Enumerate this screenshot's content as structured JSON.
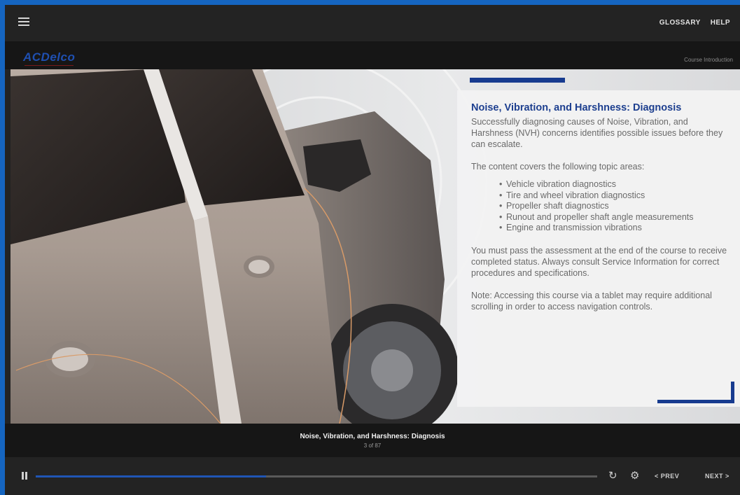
{
  "header": {
    "menu_icon": "hamburger-menu-icon",
    "links": [
      "GLOSSARY",
      "HELP"
    ]
  },
  "brand": {
    "logo_text": "ACDelco",
    "section_label": "Course Introduction"
  },
  "card": {
    "title": "Noise, Vibration, and Harshness: Diagnosis",
    "intro": "Successfully diagnosing causes of Noise, Vibration, and Harshness (NVH) concerns identifies possible issues before they can escalate.",
    "topics_lead": "The content covers the following topic areas:",
    "topics": [
      "Vehicle vibration diagnostics",
      "Tire and wheel vibration diagnostics",
      "Propeller shaft diagnostics",
      "Runout and propeller shaft angle measurements",
      "Engine and transmission vibrations"
    ],
    "assessment_note": "You must pass the assessment at the end of the course to receive completed status. Always consult Service Information for correct procedures and specifications.",
    "tablet_note": "Note: Accessing this course via a tablet may require additional scrolling in order to access navigation controls."
  },
  "slide_bar": {
    "title": "Noise, Vibration, and Harshness: Diagnosis",
    "counter": "3 of 87"
  },
  "controls": {
    "pause_icon": "pause-icon",
    "progress": 0.41,
    "replay_icon": "replay-icon",
    "settings_icon": "gear-icon",
    "prev_label": "PREV",
    "next_label": "NEXT"
  },
  "colors": {
    "accent": "#173b8f",
    "progress": "#1f55b5",
    "frame_border": "#1565c0"
  }
}
